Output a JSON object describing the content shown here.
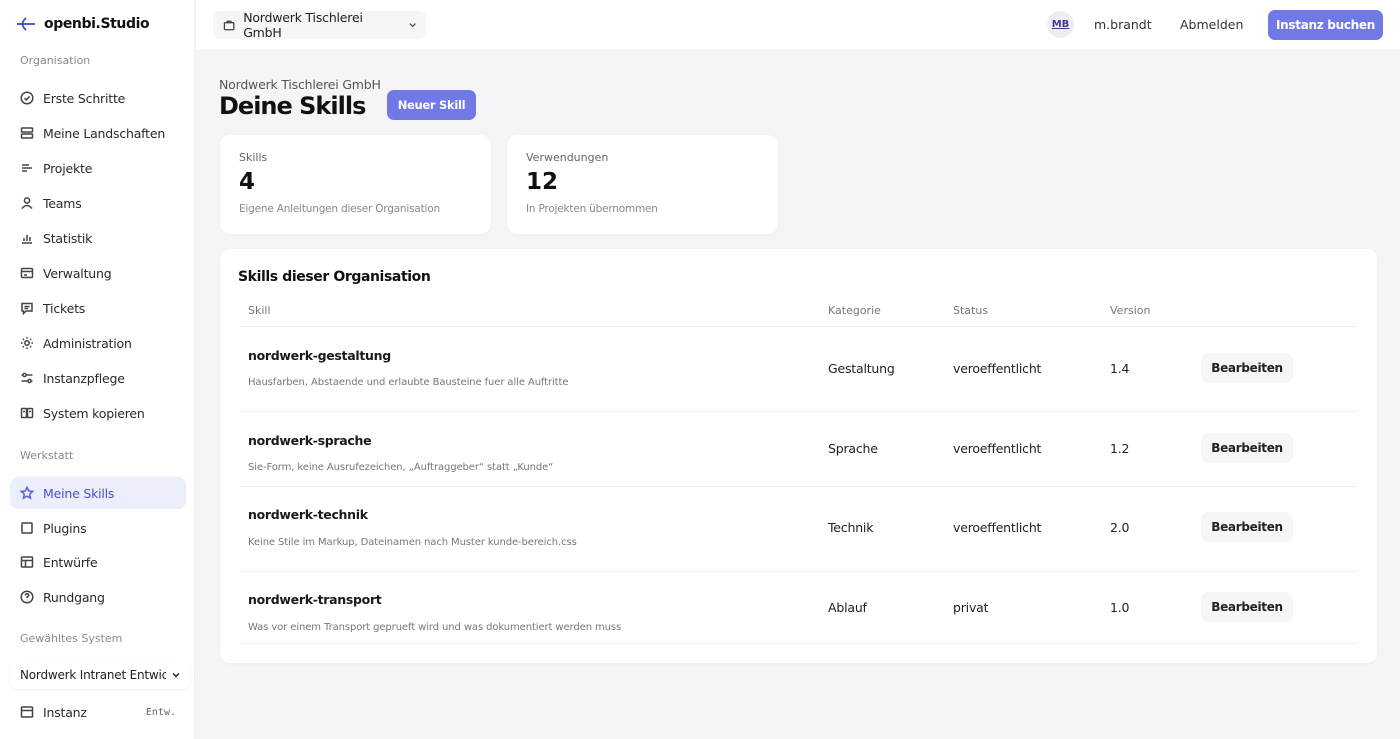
{
  "brand": {
    "name": "openbi.Studio"
  },
  "sidebar": {
    "section_org": "Organisation",
    "org_items": [
      {
        "label": "Erste Schritte",
        "icon": "check-circle-icon"
      },
      {
        "label": "Meine Landschaften",
        "icon": "server-icon"
      },
      {
        "label": "Projekte",
        "icon": "list-icon"
      },
      {
        "label": "Teams",
        "icon": "user-icon"
      },
      {
        "label": "Statistik",
        "icon": "bar-chart-icon"
      },
      {
        "label": "Verwaltung",
        "icon": "credit-card-icon"
      },
      {
        "label": "Tickets",
        "icon": "message-icon"
      },
      {
        "label": "Administration",
        "icon": "sun-icon"
      },
      {
        "label": "Instanzpflege",
        "icon": "sliders-icon"
      },
      {
        "label": "System kopieren",
        "icon": "copy-icon"
      }
    ],
    "section_workshop": "Werkstatt",
    "workshop_items": [
      {
        "label": "Meine Skills",
        "icon": "star-icon",
        "active": true
      },
      {
        "label": "Plugins",
        "icon": "square-icon"
      },
      {
        "label": "Entwürfe",
        "icon": "layout-icon"
      },
      {
        "label": "Rundgang",
        "icon": "help-circle-icon"
      }
    ],
    "section_system": "Gewähltes System",
    "system_select": "Nordwerk Intranet Entwicklung",
    "instanz": {
      "label": "Instanz",
      "tag": "Entw."
    }
  },
  "topbar": {
    "org_select": "Nordwerk Tischlerei GmbH",
    "avatar_initials": "MB",
    "user_name": "m.brandt",
    "logout": "Abmelden",
    "book_button": "Instanz buchen"
  },
  "main": {
    "org_name": "Nordwerk Tischlerei GmbH",
    "title": "Deine Skills",
    "new_button": "Neuer Skill",
    "stats": [
      {
        "label": "Skills",
        "value": "4",
        "sub": "Eigene Anleitungen dieser Organisation"
      },
      {
        "label": "Verwendungen",
        "value": "12",
        "sub": "In Projekten übernommen"
      }
    ],
    "table": {
      "title": "Skills dieser Organisation",
      "headers": {
        "skill": "Skill",
        "category": "Kategorie",
        "status": "Status",
        "version": "Version"
      },
      "edit_label": "Bearbeiten",
      "rows": [
        {
          "name": "nordwerk-gestaltung",
          "desc": "Hausfarben, Abstaende und erlaubte Bausteine fuer alle Auftritte",
          "category": "Gestaltung",
          "status": "veroeffentlicht",
          "version": "1.4"
        },
        {
          "name": "nordwerk-sprache",
          "desc": "Sie-Form, keine Ausrufezeichen, „Auftraggeber“ statt „Kunde“",
          "category": "Sprache",
          "status": "veroeffentlicht",
          "version": "1.2"
        },
        {
          "name": "nordwerk-technik",
          "desc": "Keine Stile im Markup, Dateinamen nach Muster kunde-bereich.css",
          "category": "Technik",
          "status": "veroeffentlicht",
          "version": "2.0"
        },
        {
          "name": "nordwerk-transport",
          "desc": "Was vor einem Transport geprueft wird und was dokumentiert werden muss",
          "category": "Ablauf",
          "status": "privat",
          "version": "1.0"
        }
      ]
    }
  },
  "colors": {
    "accent": "#7079e6",
    "active_bg": "#eceefb",
    "active_text": "#4a52c9"
  }
}
